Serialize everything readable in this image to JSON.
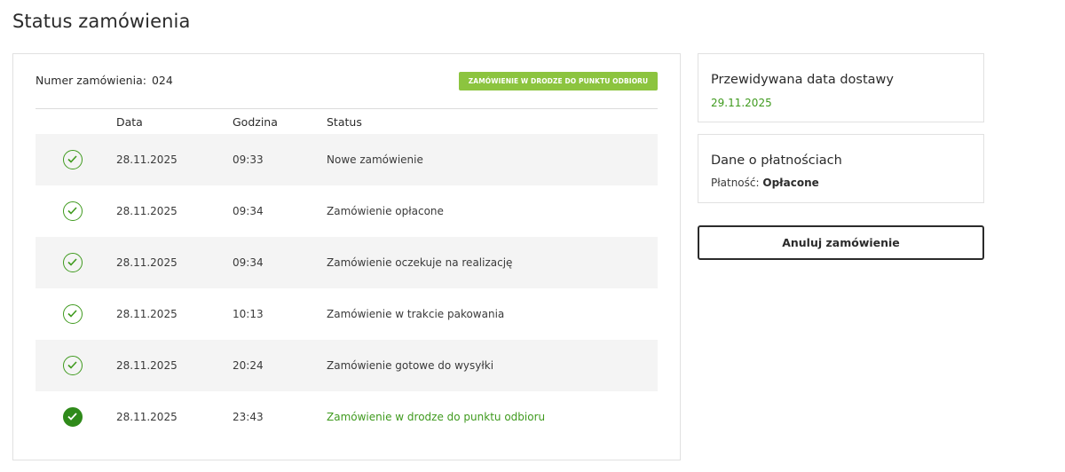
{
  "page": {
    "title": "Status zamówienia"
  },
  "order": {
    "number_label": "Numer zamówienia:",
    "number": "024",
    "badge": "ZAMÓWIENIE W DRODZE DO PUNKTU ODBIORU",
    "badge_color": "#8cc43f"
  },
  "table": {
    "headers": {
      "date": "Data",
      "time": "Godzina",
      "status": "Status"
    },
    "rows": [
      {
        "date": "28.11.2025",
        "time": "09:33",
        "status": "Nowe zamówienie",
        "icon": "check-circle-icon"
      },
      {
        "date": "28.11.2025",
        "time": "09:34",
        "status": "Zamówienie opłacone",
        "icon": "check-circle-icon"
      },
      {
        "date": "28.11.2025",
        "time": "09:34",
        "status": "Zamówienie oczekuje na realizację",
        "icon": "check-circle-icon"
      },
      {
        "date": "28.11.2025",
        "time": "10:13",
        "status": "Zamówienie w trakcie pakowania",
        "icon": "check-circle-icon"
      },
      {
        "date": "28.11.2025",
        "time": "20:24",
        "status": "Zamówienie gotowe do wysyłki",
        "icon": "check-circle-icon"
      },
      {
        "date": "28.11.2025",
        "time": "23:43",
        "status": "Zamówienie w drodze do punktu odbioru",
        "icon": "check-circle-filled-icon"
      }
    ]
  },
  "delivery": {
    "title": "Przewidywana data dostawy",
    "date": "29.11.2025"
  },
  "payment": {
    "title": "Dane o płatnościach",
    "label": "Płatność:",
    "value": "Opłacone"
  },
  "actions": {
    "cancel_label": "Anuluj zamówienie"
  },
  "colors": {
    "accent_green": "#3f9a1e",
    "badge_green": "#8cc43f",
    "row_alt": "#f4f4f4"
  }
}
